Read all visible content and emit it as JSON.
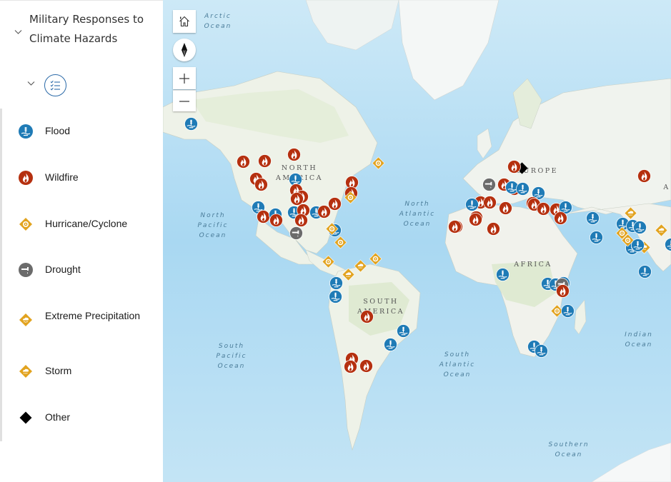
{
  "sidebar": {
    "title": "Military Responses to Climate Hazards",
    "title_chevron_icon": "chevron-down-icon",
    "legend_toggle_icon": "legend-list-icon",
    "legend": [
      {
        "label": "Flood",
        "icon": "flood-icon",
        "color": "#1f7bb6"
      },
      {
        "label": "Wildfire",
        "icon": "wildfire-icon",
        "color": "#b5300f"
      },
      {
        "label": "Hurricane/Cyclone",
        "icon": "hurricane-icon",
        "color": "#e2a31f"
      },
      {
        "label": "Drought",
        "icon": "drought-icon",
        "color": "#6b6b6b"
      },
      {
        "label": "Extreme Precipitation",
        "icon": "extreme-precipitation-icon",
        "color": "#e2a31f"
      },
      {
        "label": "Storm",
        "icon": "storm-icon",
        "color": "#e2a31f"
      },
      {
        "label": "Other",
        "icon": "other-diamond-icon",
        "color": "#000000"
      }
    ]
  },
  "map": {
    "controls": {
      "home": "home-icon",
      "compass": "compass-icon",
      "zoom_in": "+",
      "zoom_out": "−"
    },
    "ocean_labels": [
      {
        "text": "Arctic\nOcean"
      },
      {
        "text": "North\nPacific\nOcean"
      },
      {
        "text": "North\nAtlantic\nOcean"
      },
      {
        "text": "South\nPacific\nOcean"
      },
      {
        "text": "South\nAtlantic\nOcean"
      },
      {
        "text": "Indian\nOcean"
      },
      {
        "text": "Southern\nOcean"
      }
    ],
    "continent_labels": [
      {
        "text": "NORTH\nAMERICA"
      },
      {
        "text": "SOUTH\nAMERICA"
      },
      {
        "text": "EUROPE"
      },
      {
        "text": "AFRICA"
      },
      {
        "text": "A"
      }
    ],
    "markers": [
      {
        "type": "flood"
      },
      {
        "type": "wildfire"
      },
      {
        "type": "wildfire"
      },
      {
        "type": "wildfire"
      },
      {
        "type": "wildfire"
      },
      {
        "type": "wildfire"
      },
      {
        "type": "flood"
      },
      {
        "type": "wildfire"
      },
      {
        "type": "wildfire"
      },
      {
        "type": "wildfire"
      },
      {
        "type": "flood"
      },
      {
        "type": "wildfire"
      },
      {
        "type": "flood"
      },
      {
        "type": "wildfire"
      },
      {
        "type": "flood"
      },
      {
        "type": "wildfire"
      },
      {
        "type": "wildfire"
      },
      {
        "type": "drought"
      },
      {
        "type": "flood"
      },
      {
        "type": "wildfire"
      },
      {
        "type": "wildfire"
      },
      {
        "type": "wildfire"
      },
      {
        "type": "wildfire"
      },
      {
        "type": "hurricane"
      },
      {
        "type": "hurricane"
      },
      {
        "type": "flood"
      },
      {
        "type": "hurricane"
      },
      {
        "type": "hurricane"
      },
      {
        "type": "hurricane"
      },
      {
        "type": "hurricane"
      },
      {
        "type": "storm"
      },
      {
        "type": "storm"
      },
      {
        "type": "flood"
      },
      {
        "type": "flood"
      },
      {
        "type": "wildfire"
      },
      {
        "type": "flood"
      },
      {
        "type": "flood"
      },
      {
        "type": "wildfire"
      },
      {
        "type": "wildfire"
      },
      {
        "type": "wildfire"
      },
      {
        "type": "other"
      },
      {
        "type": "wildfire"
      },
      {
        "type": "drought"
      },
      {
        "type": "wildfire"
      },
      {
        "type": "wildfire"
      },
      {
        "type": "flood"
      },
      {
        "type": "flood"
      },
      {
        "type": "flood"
      },
      {
        "type": "wildfire"
      },
      {
        "type": "wildfire"
      },
      {
        "type": "flood"
      },
      {
        "type": "wildfire"
      },
      {
        "type": "wildfire"
      },
      {
        "type": "wildfire"
      },
      {
        "type": "wildfire"
      },
      {
        "type": "wildfire"
      },
      {
        "type": "wildfire"
      },
      {
        "type": "wildfire"
      },
      {
        "type": "wildfire"
      },
      {
        "type": "flood"
      },
      {
        "type": "wildfire"
      },
      {
        "type": "wildfire"
      },
      {
        "type": "wildfire"
      },
      {
        "type": "wildfire"
      },
      {
        "type": "flood"
      },
      {
        "type": "flood"
      },
      {
        "type": "flood"
      },
      {
        "type": "flood"
      },
      {
        "type": "drought"
      },
      {
        "type": "wildfire"
      },
      {
        "type": "hurricane"
      },
      {
        "type": "flood"
      },
      {
        "type": "flood"
      },
      {
        "type": "flood"
      },
      {
        "type": "wildfire"
      },
      {
        "type": "flood"
      },
      {
        "type": "flood"
      },
      {
        "type": "storm"
      },
      {
        "type": "flood"
      },
      {
        "type": "flood"
      },
      {
        "type": "flood"
      },
      {
        "type": "flood"
      },
      {
        "type": "hurricane"
      },
      {
        "type": "hurricane"
      },
      {
        "type": "flood"
      },
      {
        "type": "storm"
      },
      {
        "type": "storm"
      },
      {
        "type": "flood"
      },
      {
        "type": "storm"
      },
      {
        "type": "flood"
      }
    ]
  }
}
